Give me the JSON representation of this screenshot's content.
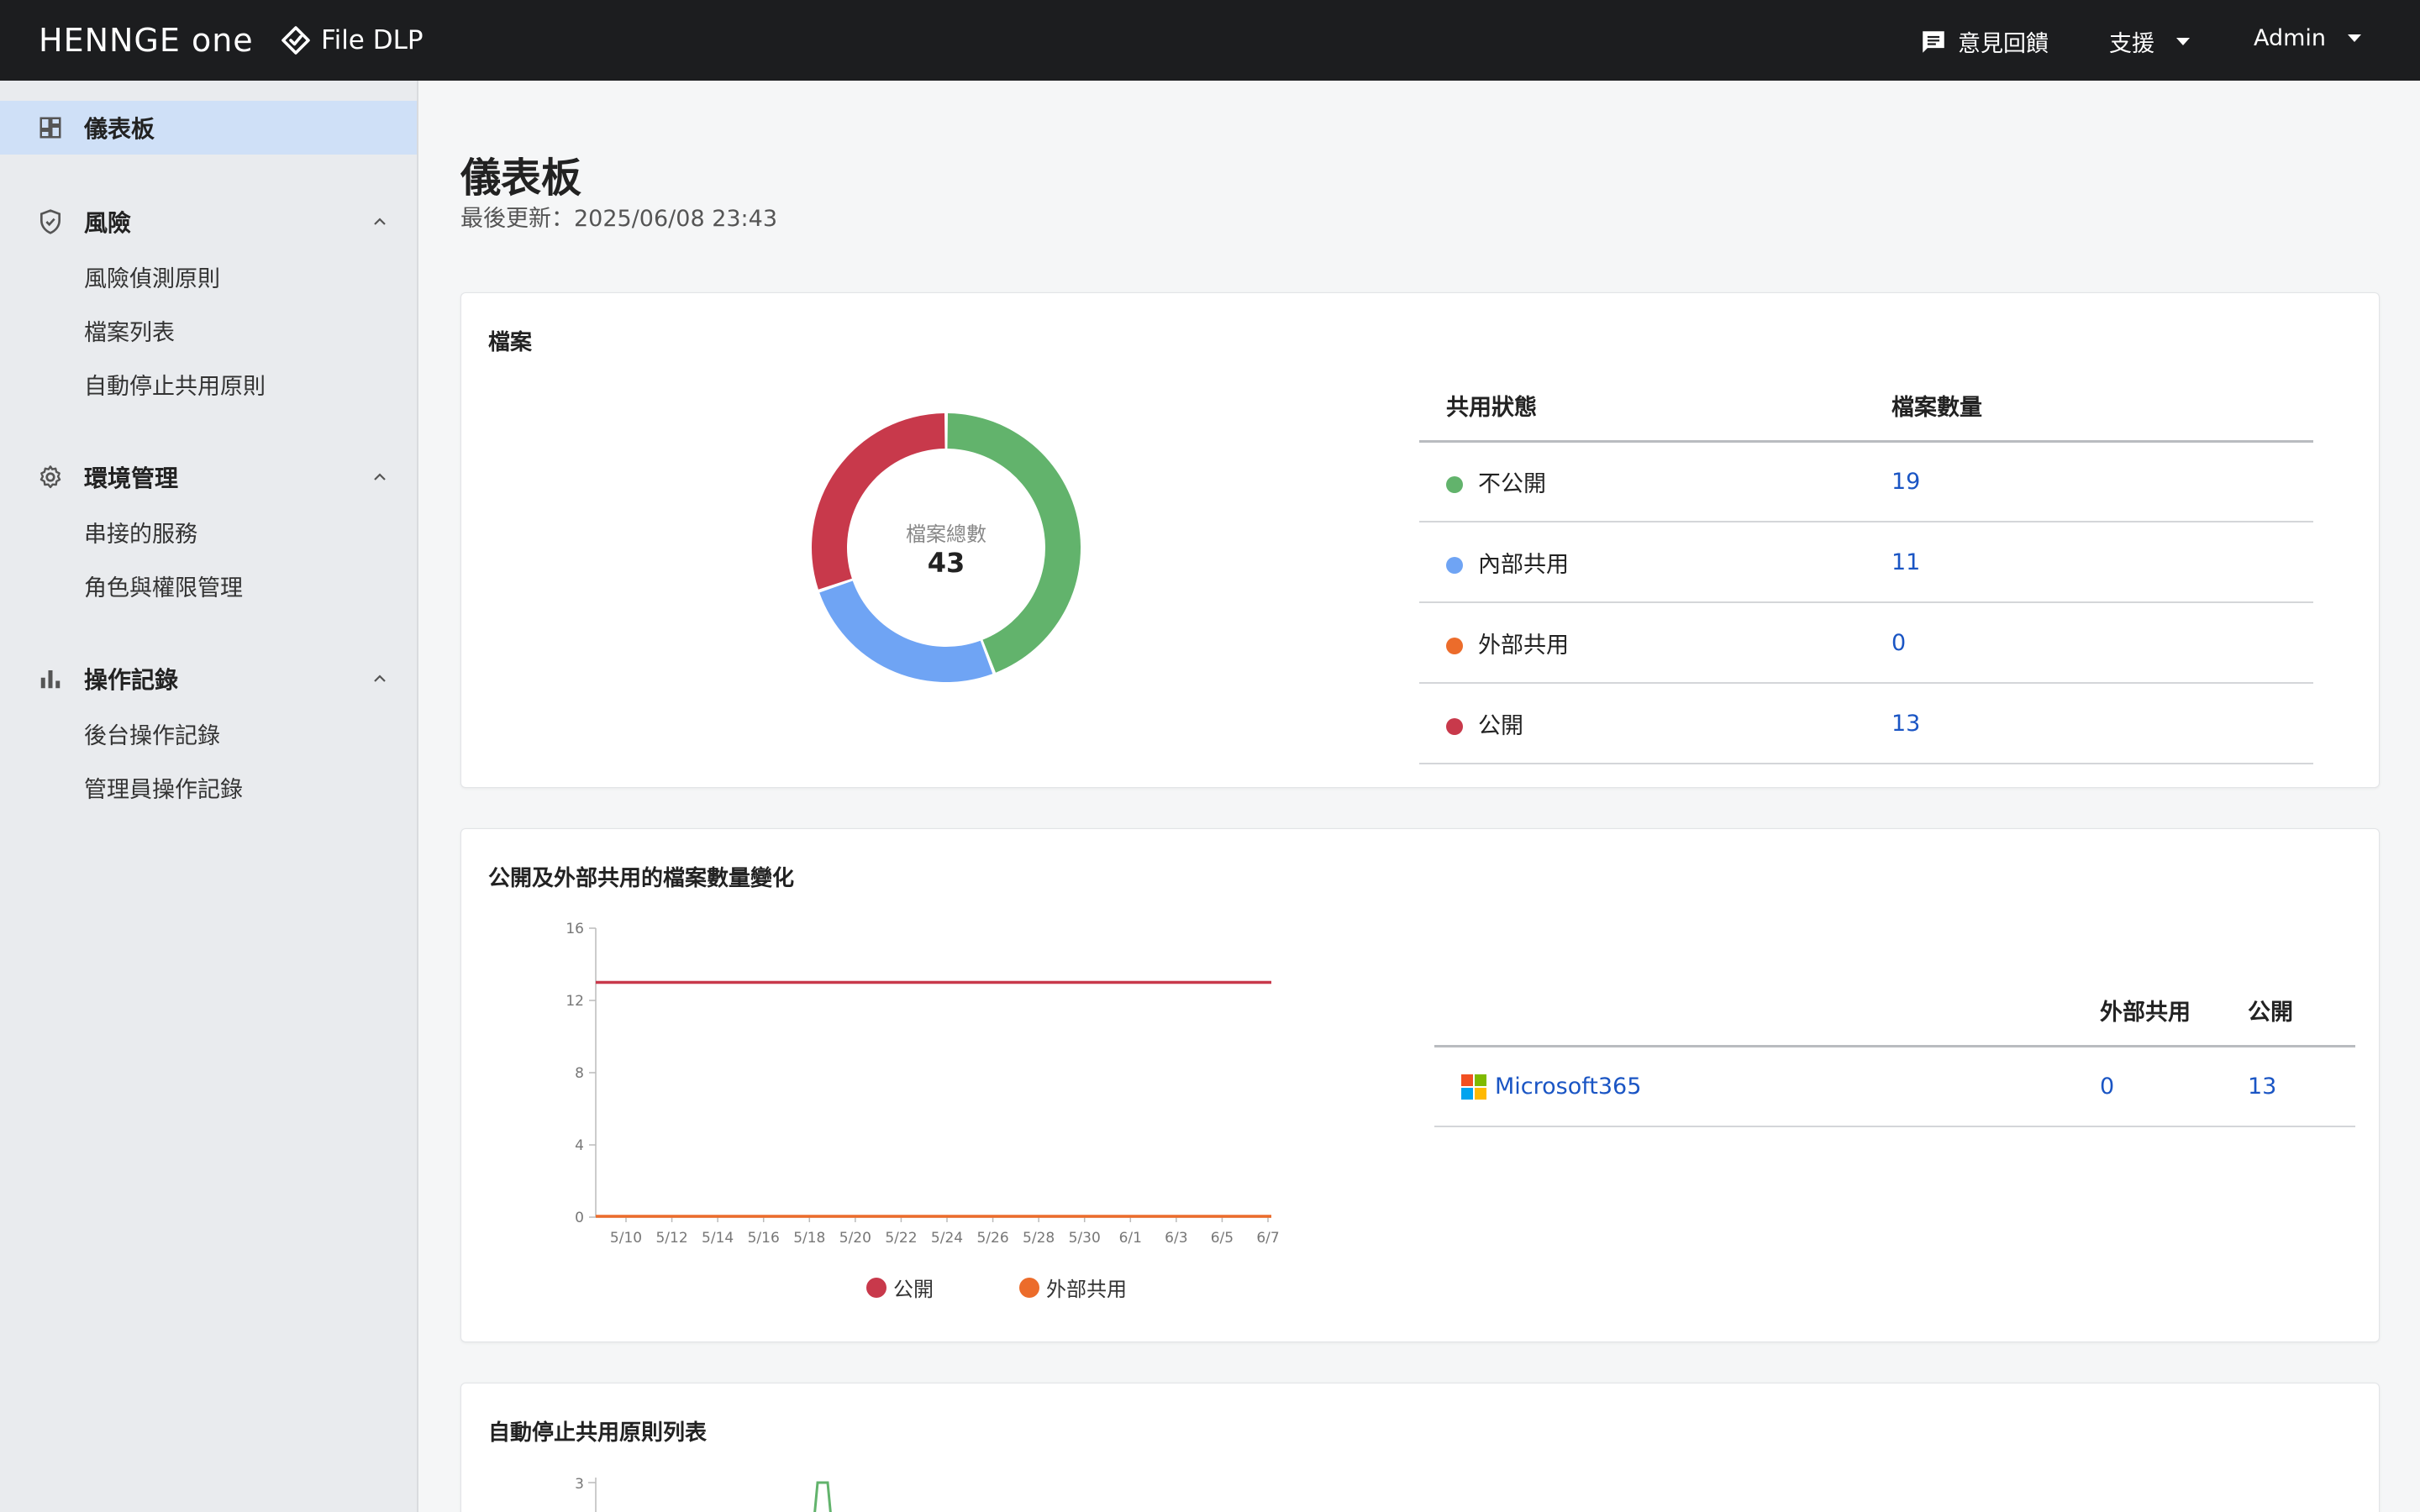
{
  "header": {
    "brand": "HENNGE one",
    "product": "File DLP",
    "feedback": "意見回饋",
    "support": "支援",
    "admin": "Admin"
  },
  "sidebar": {
    "dashboard": "儀表板",
    "risk": {
      "label": "風險",
      "items": [
        "風險偵測原則",
        "檔案列表",
        "自動停止共用原則"
      ]
    },
    "env": {
      "label": "環境管理",
      "items": [
        "串接的服務",
        "角色與權限管理"
      ]
    },
    "logs": {
      "label": "操作記錄",
      "items": [
        "後台操作記錄",
        "管理員操作記錄"
      ]
    }
  },
  "main": {
    "title": "儀表板",
    "updated": "最後更新：2025/06/08 23:43"
  },
  "files_card": {
    "title": "檔案",
    "center_label": "檔案總數",
    "center_value": "43",
    "col_status": "共用狀態",
    "col_count": "檔案數量",
    "rows": [
      {
        "label": "不公開",
        "count": "19",
        "color": "#62b36c"
      },
      {
        "label": "內部共用",
        "count": "11",
        "color": "#6fa4f4"
      },
      {
        "label": "外部共用",
        "count": "0",
        "color": "#ec6c2b"
      },
      {
        "label": "公開",
        "count": "13",
        "color": "#c8394b"
      }
    ]
  },
  "trend_card": {
    "title": "公開及外部共用的檔案數量變化",
    "col_external": "外部共用",
    "col_public": "公開",
    "service": "Microsoft365",
    "service_external": "0",
    "service_public": "13",
    "legend": [
      {
        "label": "公開",
        "color": "#c8394b"
      },
      {
        "label": "外部共用",
        "color": "#ec6c2b"
      }
    ]
  },
  "auto_card": {
    "title": "自動停止共用原則列表",
    "y_top_tick": "3"
  },
  "chart_data": [
    {
      "type": "pie",
      "categories": [
        "不公開",
        "內部共用",
        "外部共用",
        "公開"
      ],
      "values": [
        19,
        11,
        0,
        13
      ],
      "title": "檔案"
    },
    {
      "type": "line",
      "title": "公開及外部共用的檔案數量變化",
      "x": [
        "5/10",
        "5/12",
        "5/14",
        "5/16",
        "5/18",
        "5/20",
        "5/22",
        "5/24",
        "5/26",
        "5/28",
        "5/30",
        "6/1",
        "6/3",
        "6/5",
        "6/7"
      ],
      "ylim": [
        0,
        16
      ],
      "yticks": [
        0,
        4,
        8,
        12,
        16
      ],
      "series": [
        {
          "name": "公開",
          "values": [
            13,
            13,
            13,
            13,
            13,
            13,
            13,
            13,
            13,
            13,
            13,
            13,
            13,
            13,
            13
          ]
        },
        {
          "name": "外部共用",
          "values": [
            0,
            0,
            0,
            0,
            0,
            0,
            0,
            0,
            0,
            0,
            0,
            0,
            0,
            0,
            0
          ]
        }
      ],
      "legend": "bottom"
    }
  ]
}
